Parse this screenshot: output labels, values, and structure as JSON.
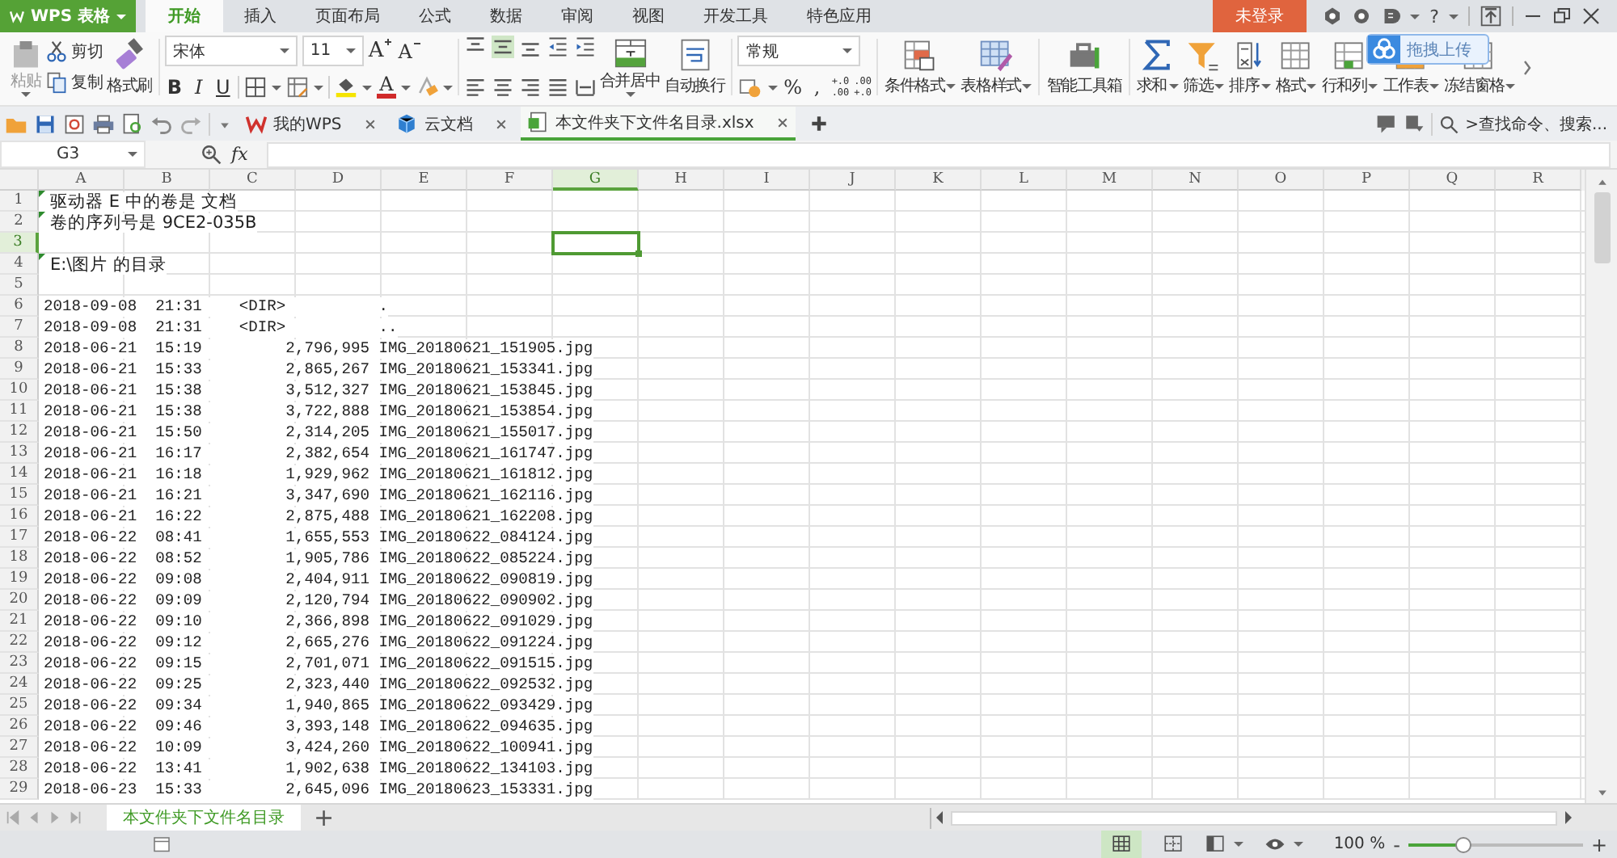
{
  "app_menu": {
    "label": "WPS 表格"
  },
  "ribbon_tabs": [
    {
      "label": "开始",
      "selected": true
    },
    {
      "label": "插入",
      "selected": false
    },
    {
      "label": "页面布局",
      "selected": false
    },
    {
      "label": "公式",
      "selected": false
    },
    {
      "label": "数据",
      "selected": false
    },
    {
      "label": "审阅",
      "selected": false
    },
    {
      "label": "视图",
      "selected": false
    },
    {
      "label": "开发工具",
      "selected": false
    },
    {
      "label": "特色应用",
      "selected": false
    }
  ],
  "account": {
    "label": "未登录"
  },
  "help": {
    "label": "?"
  },
  "upload_popup": {
    "label": "拖拽上传"
  },
  "ribbon": {
    "clipboard": {
      "paste": "粘贴",
      "cut": "剪切",
      "copy": "复制",
      "format_painter": "格式刷"
    },
    "font": {
      "name": "宋体",
      "size": "11",
      "grow": "A",
      "shrink": "A",
      "bold": "B",
      "italic": "I",
      "underline": "U",
      "font_color": "A"
    },
    "alignment": {
      "merge": "合并居中",
      "wrap": "自动换行"
    },
    "number": {
      "format": "常规",
      "percent": "%",
      "comma": ",",
      "increase_decimal": [
        "+.0",
        ".00"
      ],
      "decrease_decimal": [
        ".00",
        "+.0"
      ]
    },
    "command_groups": [
      [
        {
          "label": "条件格式",
          "kind": "conditional",
          "dropdown": true
        },
        {
          "label": "表格样式",
          "kind": "style",
          "dropdown": true
        }
      ],
      [
        {
          "label": "智能工具箱",
          "kind": "toolbox",
          "dropdown": false
        }
      ],
      [
        {
          "label": "求和",
          "kind": "sum",
          "dropdown": true
        },
        {
          "label": "筛选",
          "kind": "filter",
          "dropdown": true
        },
        {
          "label": "排序",
          "kind": "sort",
          "dropdown": true
        },
        {
          "label": "格式",
          "kind": "format",
          "dropdown": true
        },
        {
          "label": "行和列",
          "kind": "rowcol",
          "dropdown": true
        },
        {
          "label": "工作表",
          "kind": "sheet",
          "dropdown": true
        },
        {
          "label": "冻结窗格",
          "kind": "freeze",
          "dropdown": true
        }
      ]
    ]
  },
  "document_tabs": [
    {
      "label": "我的WPS",
      "kind": "wps",
      "selected": false
    },
    {
      "label": "云文档",
      "kind": "cloud",
      "selected": false
    },
    {
      "label": "本文件夹下文件名目录.xlsx",
      "kind": "sheet",
      "selected": true
    }
  ],
  "search": {
    "label": ">查找命令、搜索..."
  },
  "formula_bar": {
    "name_box": "G3",
    "function_label": "fx"
  },
  "columns": [
    {
      "label": "A",
      "selected": false
    },
    {
      "label": "B",
      "selected": false
    },
    {
      "label": "C",
      "selected": false
    },
    {
      "label": "D",
      "selected": false
    },
    {
      "label": "E",
      "selected": false
    },
    {
      "label": "F",
      "selected": false
    },
    {
      "label": "G",
      "selected": true
    },
    {
      "label": "H",
      "selected": false
    },
    {
      "label": "I",
      "selected": false
    },
    {
      "label": "J",
      "selected": false
    },
    {
      "label": "K",
      "selected": false
    },
    {
      "label": "L",
      "selected": false
    },
    {
      "label": "M",
      "selected": false
    },
    {
      "label": "N",
      "selected": false
    },
    {
      "label": "O",
      "selected": false
    },
    {
      "label": "P",
      "selected": false
    },
    {
      "label": "Q",
      "selected": false
    },
    {
      "label": "R",
      "selected": false
    }
  ],
  "rows": [
    {
      "number": "1",
      "kind": "note",
      "text": "驱动器 E 中的卷是 文档",
      "marked": true,
      "selected": false
    },
    {
      "number": "2",
      "kind": "note",
      "text": "卷的序列号是 9CE2-035B",
      "marked": true,
      "selected": false
    },
    {
      "number": "3",
      "kind": "blank",
      "marked": false,
      "selected": true
    },
    {
      "number": "4",
      "kind": "note",
      "text": "E:\\图片 的目录",
      "marked": true,
      "selected": false
    },
    {
      "number": "5",
      "kind": "blank",
      "marked": false,
      "selected": false
    },
    {
      "number": "6",
      "kind": "entry",
      "text": "2018-09-08  21:31    <DIR>          .",
      "marked": false,
      "selected": false
    },
    {
      "number": "7",
      "kind": "entry",
      "text": "2018-09-08  21:31    <DIR>          ..",
      "marked": false,
      "selected": false
    },
    {
      "number": "8",
      "kind": "entry",
      "text": "2018-06-21  15:19         2,796,995 IMG_20180621_151905.jpg",
      "marked": false,
      "selected": false
    },
    {
      "number": "9",
      "kind": "entry",
      "text": "2018-06-21  15:33         2,865,267 IMG_20180621_153341.jpg",
      "marked": false,
      "selected": false
    },
    {
      "number": "10",
      "kind": "entry",
      "text": "2018-06-21  15:38         3,512,327 IMG_20180621_153845.jpg",
      "marked": false,
      "selected": false
    },
    {
      "number": "11",
      "kind": "entry",
      "text": "2018-06-21  15:38         3,722,888 IMG_20180621_153854.jpg",
      "marked": false,
      "selected": false
    },
    {
      "number": "12",
      "kind": "entry",
      "text": "2018-06-21  15:50         2,314,205 IMG_20180621_155017.jpg",
      "marked": false,
      "selected": false
    },
    {
      "number": "13",
      "kind": "entry",
      "text": "2018-06-21  16:17         2,382,654 IMG_20180621_161747.jpg",
      "marked": false,
      "selected": false
    },
    {
      "number": "14",
      "kind": "entry",
      "text": "2018-06-21  16:18         1,929,962 IMG_20180621_161812.jpg",
      "marked": false,
      "selected": false
    },
    {
      "number": "15",
      "kind": "entry",
      "text": "2018-06-21  16:21         3,347,690 IMG_20180621_162116.jpg",
      "marked": false,
      "selected": false
    },
    {
      "number": "16",
      "kind": "entry",
      "text": "2018-06-21  16:22         2,875,488 IMG_20180621_162208.jpg",
      "marked": false,
      "selected": false
    },
    {
      "number": "17",
      "kind": "entry",
      "text": "2018-06-22  08:41         1,655,553 IMG_20180622_084124.jpg",
      "marked": false,
      "selected": false
    },
    {
      "number": "18",
      "kind": "entry",
      "text": "2018-06-22  08:52         1,905,786 IMG_20180622_085224.jpg",
      "marked": false,
      "selected": false
    },
    {
      "number": "19",
      "kind": "entry",
      "text": "2018-06-22  09:08         2,404,911 IMG_20180622_090819.jpg",
      "marked": false,
      "selected": false
    },
    {
      "number": "20",
      "kind": "entry",
      "text": "2018-06-22  09:09         2,120,794 IMG_20180622_090902.jpg",
      "marked": false,
      "selected": false
    },
    {
      "number": "21",
      "kind": "entry",
      "text": "2018-06-22  09:10         2,366,898 IMG_20180622_091029.jpg",
      "marked": false,
      "selected": false
    },
    {
      "number": "22",
      "kind": "entry",
      "text": "2018-06-22  09:12         2,665,276 IMG_20180622_091224.jpg",
      "marked": false,
      "selected": false
    },
    {
      "number": "23",
      "kind": "entry",
      "text": "2018-06-22  09:15         2,701,071 IMG_20180622_091515.jpg",
      "marked": false,
      "selected": false
    },
    {
      "number": "24",
      "kind": "entry",
      "text": "2018-06-22  09:25         2,323,440 IMG_20180622_092532.jpg",
      "marked": false,
      "selected": false
    },
    {
      "number": "25",
      "kind": "entry",
      "text": "2018-06-22  09:34         1,940,865 IMG_20180622_093429.jpg",
      "marked": false,
      "selected": false
    },
    {
      "number": "26",
      "kind": "entry",
      "text": "2018-06-22  09:46         3,393,148 IMG_20180622_094635.jpg",
      "marked": false,
      "selected": false
    },
    {
      "number": "27",
      "kind": "entry",
      "text": "2018-06-22  10:09         3,424,260 IMG_20180622_100941.jpg",
      "marked": false,
      "selected": false
    },
    {
      "number": "28",
      "kind": "entry",
      "text": "2018-06-22  13:41         1,902,638 IMG_20180622_134103.jpg",
      "marked": false,
      "selected": false
    },
    {
      "number": "29",
      "kind": "entry",
      "text": "2018-06-23  15:33         2,645,096 IMG_20180623_153331.jpg",
      "marked": false,
      "selected": false
    }
  ],
  "sheet_tabs": [
    {
      "label": "本文件夹下文件名目录",
      "selected": true
    }
  ],
  "add_sheet": {
    "label": "+"
  },
  "status_bar": {
    "zoom": "100 %",
    "zoom_out": "-",
    "zoom_in": "+",
    "zoom_level": {
      "level": 0.32
    }
  }
}
